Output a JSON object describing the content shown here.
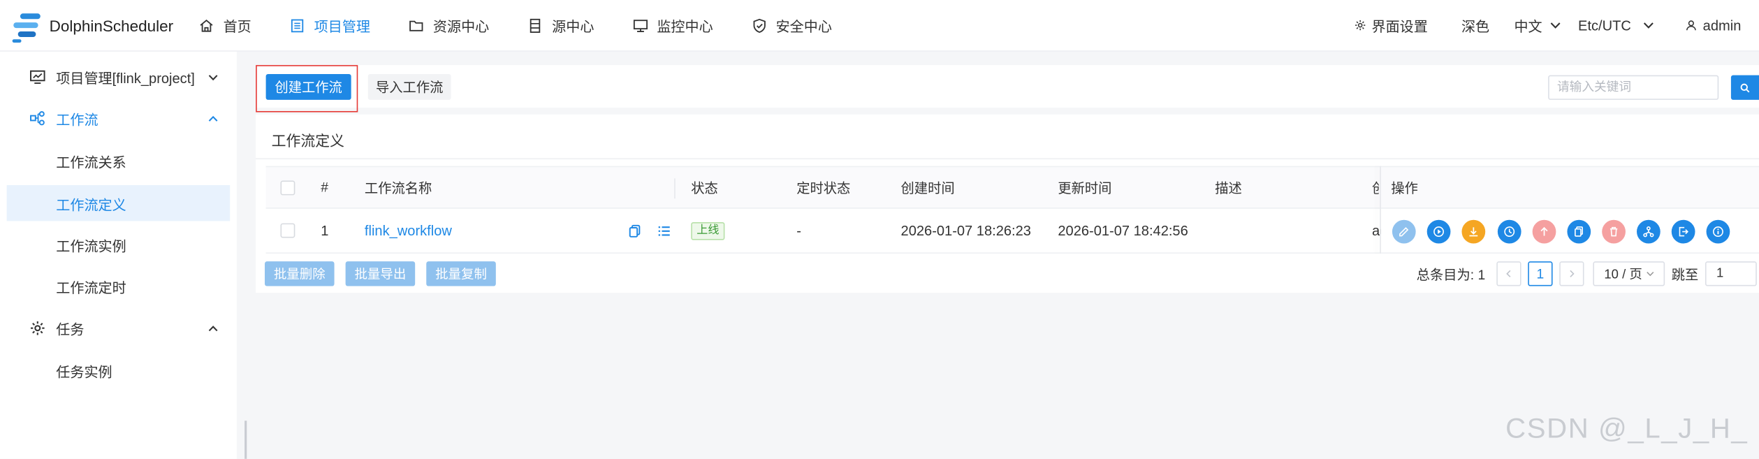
{
  "header": {
    "logo_text": "DolphinScheduler",
    "nav": [
      {
        "label": "首页"
      },
      {
        "label": "项目管理"
      },
      {
        "label": "资源中心"
      },
      {
        "label": "源中心"
      },
      {
        "label": "监控中心"
      },
      {
        "label": "安全中心"
      }
    ],
    "ui_settings": "界面设置",
    "theme": "深色",
    "language": "中文",
    "timezone": "Etc/UTC",
    "user": "admin"
  },
  "sidebar": {
    "project": "项目管理[flink_project]",
    "workflow": "工作流",
    "workflow_items": [
      "工作流关系",
      "工作流定义",
      "工作流实例",
      "工作流定时"
    ],
    "task": "任务",
    "task_items": [
      "任务实例"
    ]
  },
  "toolbar": {
    "create_label": "创建工作流",
    "import_label": "导入工作流",
    "search_placeholder": "请输入关键词"
  },
  "card": {
    "title": "工作流定义",
    "columns": {
      "index": "#",
      "name": "工作流名称",
      "status": "状态",
      "schedule_status": "定时状态",
      "create_time": "创建时间",
      "update_time": "更新时间",
      "description": "描述",
      "creator_partial": "创",
      "operations": "操作"
    },
    "rows": [
      {
        "index": "1",
        "name": "flink_workflow",
        "status": "上线",
        "schedule_status": "-",
        "create_time": "2026-01-07 18:26:23",
        "update_time": "2026-01-07 18:42:56",
        "description": "",
        "creator_partial": "ac"
      }
    ],
    "batch": {
      "delete": "批量删除",
      "export": "批量导出",
      "copy": "批量复制"
    },
    "pager": {
      "total": "总条目为: 1",
      "current": "1",
      "page_size": "10 / 页",
      "jump_label": "跳至",
      "jump_value": "1"
    }
  },
  "watermark": "CSDN @_L_J_H_",
  "colors": {
    "primary": "#1e88e5",
    "edit": "#8fc1ee",
    "orange": "#f5a623",
    "red_light": "#f5a0a0",
    "tag_green": "#3a9a34"
  }
}
